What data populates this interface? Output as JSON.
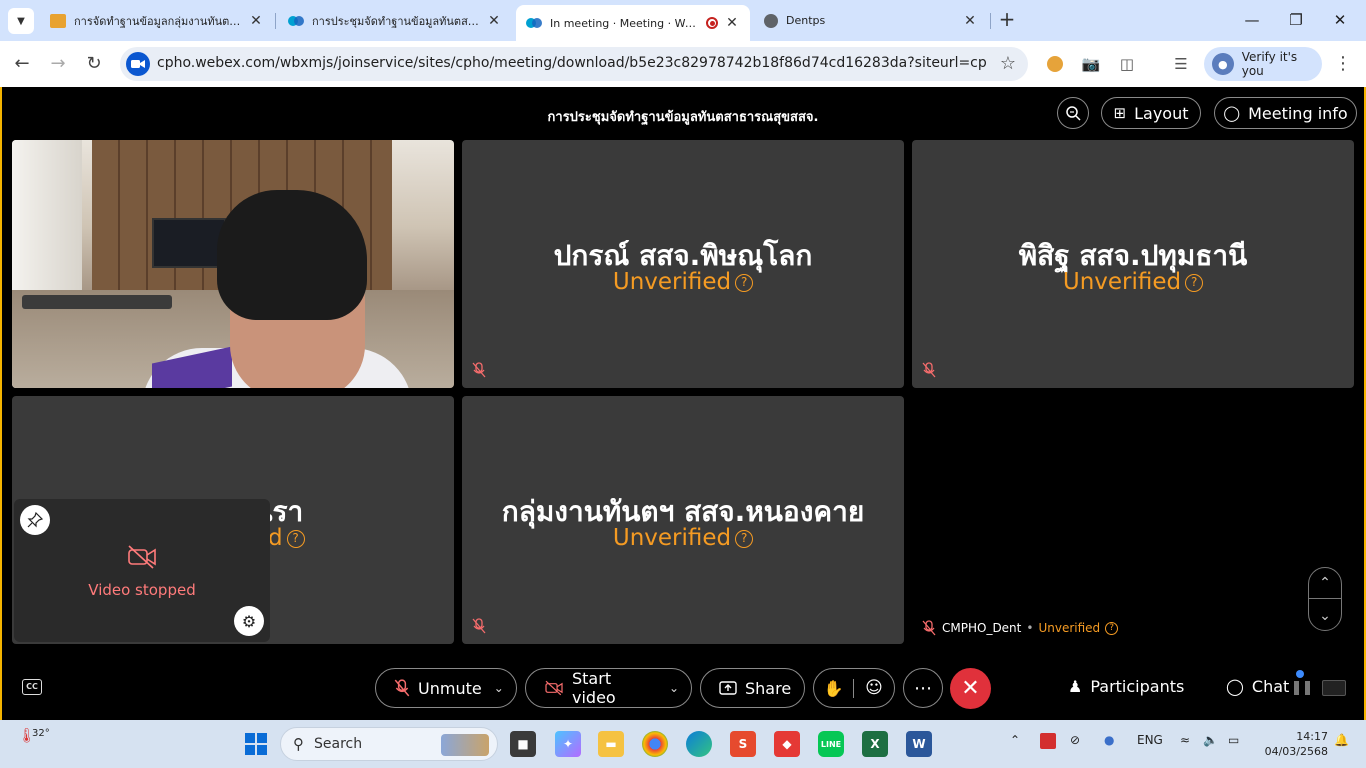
{
  "browser": {
    "tabs": [
      {
        "title": "การจัดทำฐานข้อมูลกลุ่มงานทันตสาธ",
        "active": false
      },
      {
        "title": "การประชุมจัดทำฐานข้อมูลทันตสาธารณ",
        "active": false
      },
      {
        "title": "In meeting · Meeting · Webex",
        "active": true
      },
      {
        "title": "Dentps",
        "active": false
      }
    ],
    "url": "cpho.webex.com/wbxmjs/joinservice/sites/cpho/meeting/download/b5e23c82978742b18f86d74cd16283da?siteurl=cpho&MTID=m...",
    "verify_label": "Verify it's you"
  },
  "meeting": {
    "title": "การประชุมจัดทำฐานข้อมูลทันตสาธารณสุขสสจ.",
    "top_buttons": {
      "layout": "Layout",
      "info": "Meeting info"
    },
    "participants": [
      {
        "name": "ปกรณ์ สสจ.พิษณุโลก",
        "status": "Unverified"
      },
      {
        "name": "พิสิฐ สสจ.ปทุมธานี",
        "status": "Unverified"
      },
      {
        "name": ".นรา",
        "status": "d"
      },
      {
        "name": "กลุ่มงานทันตฯ สสจ.หนองคาย",
        "status": "Unverified"
      },
      {
        "name": "CMPHO_Dent",
        "status": "Unverified"
      }
    ],
    "self_view": {
      "label": "Video stopped"
    },
    "controls": {
      "unmute": "Unmute",
      "start_video": "Start video",
      "share": "Share",
      "participants": "Participants",
      "chat": "Chat"
    }
  },
  "taskbar": {
    "weather_temp": "32°",
    "search_placeholder": "Search",
    "language": "ENG",
    "time": "14:17",
    "date": "04/03/2568"
  }
}
